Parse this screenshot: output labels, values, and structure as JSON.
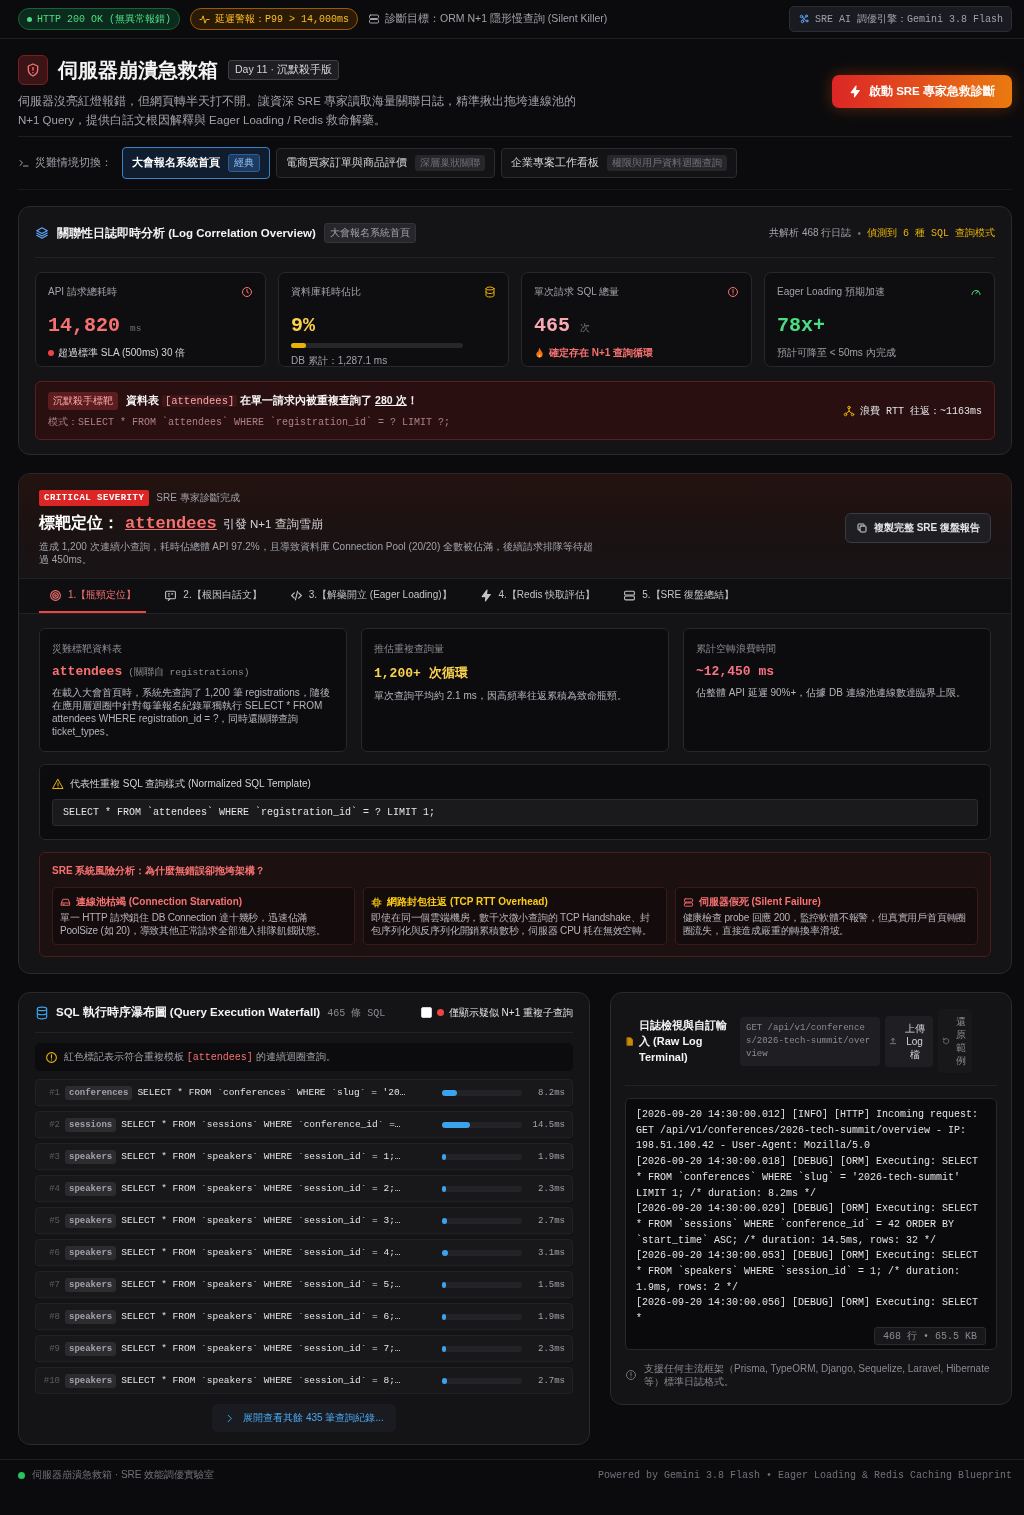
{
  "status_bar": {
    "http_status": "HTTP 200 OK (無異常報錯)",
    "latency_alert": "延遲警報：P99 > 14,000ms",
    "diagnosis_target": "診斷目標：ORM N+1 隱形慢查詢 (Silent Killer)",
    "engine": "SRE AI 調優引擎：Gemini 3.8 Flash"
  },
  "header": {
    "title": "伺服器崩潰急救箱",
    "edition": "Day 11 · 沉默殺手版",
    "description": "伺服器沒亮紅燈報錯，但網頁轉半天打不開。讓資深 SRE 專家讀取海量關聯日誌，精準揪出拖垮連線池的 N+1 Query，提供白話文根因解釋與 Eager Loading / Redis 救命解藥。",
    "action": "啟動 SRE 專家急救診斷"
  },
  "scenario_switcher": {
    "label": "災難情境切換：",
    "scenarios": [
      {
        "label": "大會報名系統首頁",
        "tag": "經典",
        "selected": true
      },
      {
        "label": "電商買家訂單與商品評價",
        "tag": "深層巢狀關聯",
        "selected": false
      },
      {
        "label": "企業專案工作看板",
        "tag": "權限與用戶資料迴圈查詢",
        "selected": false
      }
    ]
  },
  "overview": {
    "title": "關聯性日誌即時分析 (Log Correlation Overview)",
    "scenario_tag": "大會報名系統首頁",
    "parsed_summary": "共解析 468 行日誌",
    "summary_separator": "•",
    "detected_summary": "偵測到 6 種 SQL 查詢模式",
    "metrics": [
      {
        "kind": "duration",
        "label": "API 請求總耗時",
        "value": "14,820",
        "unit": "ms",
        "note": "超過標準 SLA (500ms) 30 倍"
      },
      {
        "kind": "share",
        "label": "資料庫耗時佔比",
        "value": "9%",
        "level": 0.09,
        "note": "DB 累計：1,287.1 ms"
      },
      {
        "kind": "count",
        "label": "單次請求 SQL 總量",
        "value": "465",
        "unit": "次",
        "note": "確定存在 N+1 查詢循環"
      },
      {
        "kind": "speedup",
        "label": "Eager Loading 預期加速",
        "value": "78x+",
        "note": "預計可降至 < 50ms 內完成"
      }
    ],
    "alert": {
      "tag": "沉默殺手標靶",
      "message": "資料表 **[attendees]** 在單一請求內被重複查詢了 *280 次*！",
      "pattern": "模式：SELECT * FROM `attendees` WHERE `registration_id` = ? LIMIT ?;",
      "rtt": "浪費 RTT 往返：~1163ms"
    }
  },
  "diagnosis": {
    "severity": "CRITICAL SEVERITY",
    "status": "SRE 專家診斷完成",
    "target_label": "標靶定位：",
    "target": "attendees",
    "target_effect": "引發 N+1 查詢雪崩",
    "summary": "造成 1,200 次連續小查詢，耗時佔總體 API 97.2%，且導致資料庫 Connection Pool (20/20) 全數被佔滿，後續請求排隊等待超過 450ms。",
    "copy_action": "複製完整 SRE 復盤報告",
    "tabs": [
      {
        "kind": "target",
        "label": "1.【瓶頸定位】",
        "selected": true
      },
      {
        "kind": "explain",
        "label": "2.【根因白話文】",
        "selected": false
      },
      {
        "kind": "code",
        "label": "3.【解藥開立 (Eager Loading)】",
        "selected": false
      },
      {
        "kind": "cache",
        "label": "4.【Redis 快取評估】",
        "selected": false
      },
      {
        "kind": "summary",
        "label": "5.【SRE 復盤總結】",
        "selected": false
      }
    ],
    "findings": [
      {
        "kind": "table",
        "label": "災難標靶資料表",
        "value": "attendees",
        "value_note": "(關聯自 registrations)",
        "detail": "在載入大會首頁時，系統先查詢了 1,200 筆 registrations，隨後在應用層迴圈中針對每筆報名紀錄單獨執行 SELECT * FROM attendees WHERE registration_id = ?，同時還關聯查詢 ticket_types。"
      },
      {
        "kind": "volume",
        "label": "推估重複查詢量",
        "value": "1,200+ 次循環",
        "detail": "單次查詢平均約 2.1 ms，因高頻率往返累積為致命瓶頸。"
      },
      {
        "kind": "waste",
        "label": "累計空轉浪費時間",
        "value": "~12,450 ms",
        "detail": "佔整體 API 延遲 90%+，佔據 DB 連線池連線數達臨界上限。"
      }
    ],
    "template": {
      "title": "代表性重複 SQL 查詢樣式 (Normalized SQL Template)",
      "sql": "SELECT * FROM `attendees` WHERE `registration_id` = ? LIMIT 1;"
    },
    "risks": {
      "title": "SRE 系統風險分析：為什麼無錯誤卻拖垮架構？",
      "items": [
        {
          "kind": "pool",
          "title": "連線池枯竭 (Connection Starvation)",
          "detail": "單一 HTTP 請求鎖住 DB Connection 達十幾秒，迅速佔滿 PoolSize (如 20)，導致其他正常請求全部進入排隊飢餓狀態。"
        },
        {
          "kind": "network",
          "title": "網路封包往返 (TCP RTT Overhead)",
          "detail": "即使在同一個雲端機房，數千次微小查詢的 TCP Handshake、封包序列化與反序列化開銷累積數秒，伺服器 CPU 耗在無效空轉。"
        },
        {
          "kind": "server",
          "title": "伺服器假死 (Silent Failure)",
          "detail": "健康檢查 probe 回應 200，監控軟體不報警，但真實用戶首頁轉圈圈流失，直接造成嚴重的轉換率滑坡。"
        }
      ]
    }
  },
  "waterfall": {
    "title": "SQL 執行時序瀑布圖 (Query Execution Waterfall)",
    "count": "465 條 SQL",
    "filter": {
      "label": "僅顯示疑似 N+1 重複子查詢",
      "checked": false
    },
    "hint": "紅色標記表示符合重複模板 **[attendees]** 的連續迴圈查詢。",
    "rows": [
      {
        "index": "#1",
        "table": "conferences",
        "sql": "SELECT * FROM `conferences` WHERE `slug` = '20…",
        "level": 0.19,
        "duration": "8.2ms"
      },
      {
        "index": "#2",
        "table": "sessions",
        "sql": "SELECT * FROM `sessions` WHERE `conference_id` =…",
        "level": 0.35,
        "duration": "14.5ms"
      },
      {
        "index": "#3",
        "table": "speakers",
        "sql": "SELECT * FROM `speakers` WHERE `session_id` = 1;…",
        "level": 0.04,
        "duration": "1.9ms"
      },
      {
        "index": "#4",
        "table": "speakers",
        "sql": "SELECT * FROM `speakers` WHERE `session_id` = 2;…",
        "level": 0.055,
        "duration": "2.3ms"
      },
      {
        "index": "#5",
        "table": "speakers",
        "sql": "SELECT * FROM `speakers` WHERE `session_id` = 3;…",
        "level": 0.065,
        "duration": "2.7ms"
      },
      {
        "index": "#6",
        "table": "speakers",
        "sql": "SELECT * FROM `speakers` WHERE `session_id` = 4;…",
        "level": 0.075,
        "duration": "3.1ms"
      },
      {
        "index": "#7",
        "table": "speakers",
        "sql": "SELECT * FROM `speakers` WHERE `session_id` = 5;…",
        "level": 0.035,
        "duration": "1.5ms"
      },
      {
        "index": "#8",
        "table": "speakers",
        "sql": "SELECT * FROM `speakers` WHERE `session_id` = 6;…",
        "level": 0.04,
        "duration": "1.9ms"
      },
      {
        "index": "#9",
        "table": "speakers",
        "sql": "SELECT * FROM `speakers` WHERE `session_id` = 7;…",
        "level": 0.055,
        "duration": "2.3ms"
      },
      {
        "index": "#10",
        "table": "speakers",
        "sql": "SELECT * FROM `speakers` WHERE `session_id` = 8;…",
        "level": 0.065,
        "duration": "2.7ms"
      }
    ],
    "more": "展開查看其餘 435 筆查詢紀錄..."
  },
  "log_terminal": {
    "title": "日誌檢視與自訂輸入 (Raw Log Terminal)",
    "endpoint": "GET /api/v1/conferences/2026-tech-summit/overview",
    "upload": "上傳 Log 檔",
    "reset": "還原範例",
    "log_lines": [
      "[2026-09-20 14:30:00.012] [INFO] [HTTP] Incoming request: GET /api/v1/conferences/2026-tech-summit/overview - IP: 198.51.100.42 - User-Agent: Mozilla/5.0",
      "[2026-09-20 14:30:00.018] [DEBUG] [ORM] Executing: SELECT * FROM `conferences` WHERE `slug` = '2026-tech-summit' LIMIT 1; /* duration: 8.2ms */",
      "[2026-09-20 14:30:00.029] [DEBUG] [ORM] Executing: SELECT * FROM `sessions` WHERE `conference_id` = 42 ORDER BY `start_time` ASC; /* duration: 14.5ms, rows: 32 */",
      "[2026-09-20 14:30:00.053] [DEBUG] [ORM] Executing: SELECT * FROM `speakers` WHERE `session_id` = 1; /* duration: 1.9ms, rows: 2 */",
      "[2026-09-20 14:30:00.056] [DEBUG] [ORM] Executing: SELECT *"
    ],
    "stats": "468 行 • 65.5 KB",
    "support_note": "支援任何主流框架（Prisma, TypeORM, Django, Sequelize, Laravel, Hibernate 等）標準日誌格式。"
  },
  "footer": {
    "left": "伺服器崩潰急救箱 · SRE 效能調優實驗室",
    "right": "Powered by Gemini 3.8 Flash • Eager Loading & Redis Caching Blueprint"
  }
}
